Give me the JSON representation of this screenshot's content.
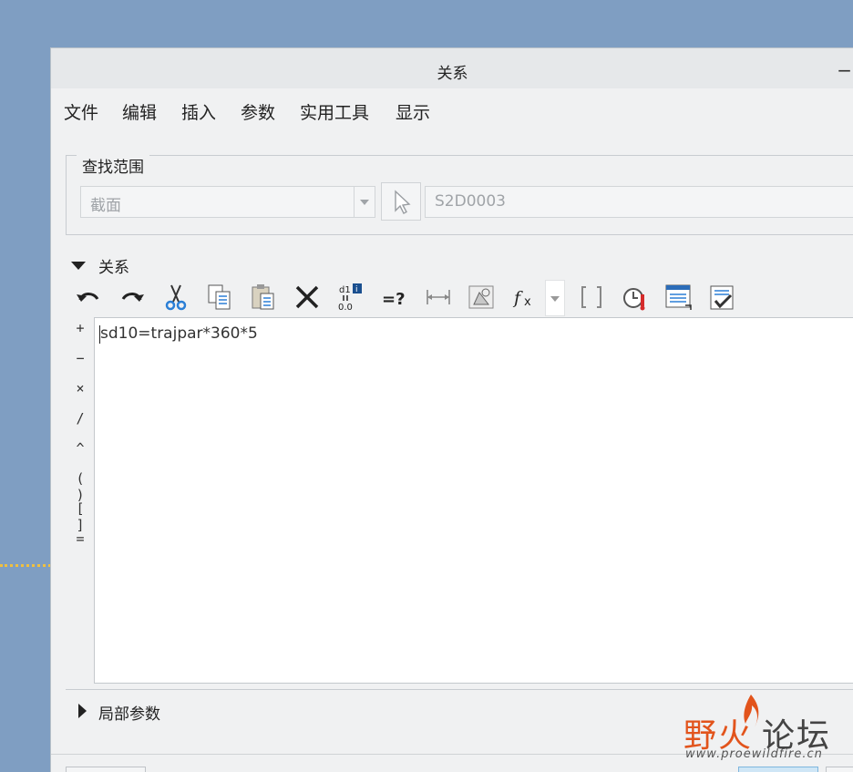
{
  "dialog": {
    "title": "关系",
    "minimize_glyph": "−"
  },
  "menu": [
    "文件",
    "编辑",
    "插入",
    "参数",
    "实用工具",
    "显示"
  ],
  "lookup": {
    "label": "查找范围",
    "type_value": "截面",
    "reference_value": "S2D0003"
  },
  "relations": {
    "label": "关系",
    "toolbar_icons": [
      "undo-icon",
      "redo-icon",
      "cut-icon",
      "copy-icon",
      "paste-icon",
      "delete-icon",
      "switch-dims-icon",
      "evaluate-icon",
      "dimension-icon",
      "measure-icon",
      "function-icon",
      "brackets-icon",
      "verify-icon",
      "sort-icon",
      "check-icon"
    ],
    "operators": [
      "+",
      "−",
      "×",
      "/",
      "^",
      "( )",
      "[ ]",
      "="
    ],
    "text": "sd10=trajpar*360*5"
  },
  "local_params": {
    "label": "局部参数"
  },
  "watermark": {
    "brand_cn_1": "野火",
    "brand_cn_2": "论坛",
    "url": "www.proewildfire.cn"
  },
  "colors": {
    "desktop": "#7f9ec2",
    "dialog_bg": "#f0f1f2",
    "brand": "#e2541c"
  }
}
